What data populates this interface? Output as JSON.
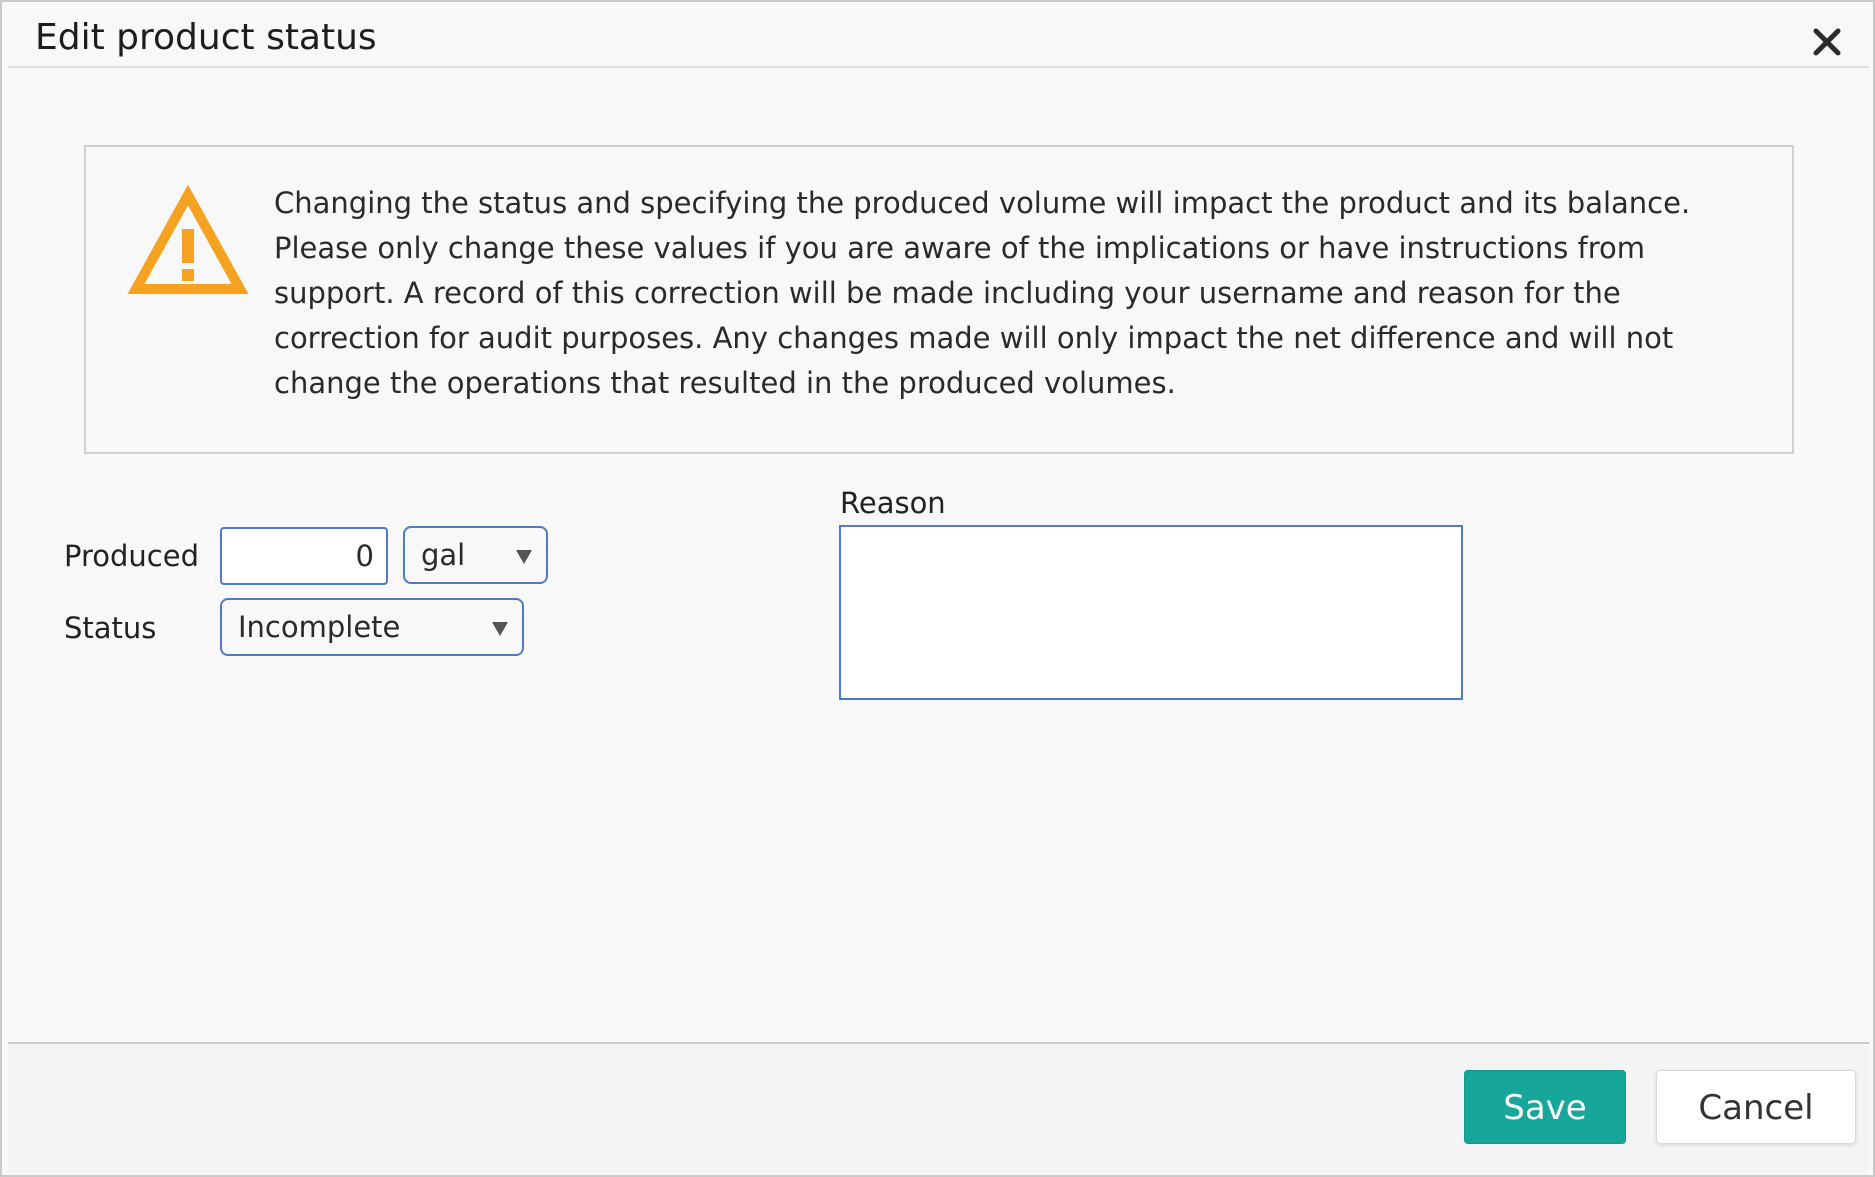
{
  "dialog": {
    "title": "Edit product status"
  },
  "warning": {
    "text": "Changing the status and specifying the produced volume will impact the product and its balance. Please only change these values if you are aware of the implications or have instructions from support. A record of this correction will be made including your username and reason for the correction for audit purposes. Any changes made will only impact the net difference and will not change the operations that resulted in the produced volumes.",
    "icon": "warning-triangle-icon",
    "icon_color": "#f4a21f"
  },
  "form": {
    "produced_label": "Produced",
    "produced_value": "0",
    "unit_value": "gal",
    "status_label": "Status",
    "status_value": "Incomplete",
    "reason_label": "Reason",
    "reason_value": ""
  },
  "footer": {
    "save_label": "Save",
    "cancel_label": "Cancel"
  },
  "colors": {
    "accent": "#17a79a",
    "input_border": "#4f79c9"
  }
}
